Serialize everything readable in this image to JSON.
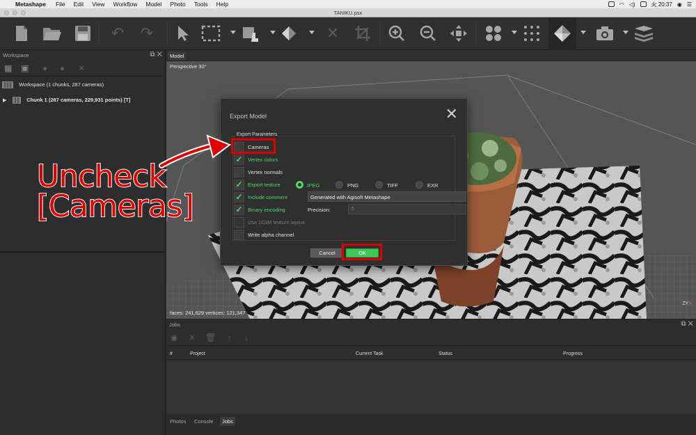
{
  "mac_menubar": {
    "app_name": "Metashape",
    "menus": [
      "File",
      "Edit",
      "View",
      "Workflow",
      "Model",
      "Photo",
      "Tools",
      "Help"
    ],
    "clock": "火 20:37"
  },
  "window": {
    "title": "TANIKU.psx"
  },
  "toolbar": {
    "buttons": [
      {
        "icon": "new-document-icon",
        "enabled": true
      },
      {
        "icon": "open-folder-icon",
        "enabled": true
      },
      {
        "icon": "save-icon",
        "enabled": true
      },
      {
        "icon": "undo-icon",
        "enabled": false
      },
      {
        "icon": "redo-icon",
        "enabled": false
      },
      {
        "icon": "navigation-arrow-icon",
        "enabled": true
      },
      {
        "icon": "rectangle-selection-icon",
        "enabled": true
      },
      {
        "icon": "move-object-icon",
        "enabled": true
      },
      {
        "icon": "rotate-object-icon",
        "enabled": true
      },
      {
        "icon": "delete-selection-icon",
        "enabled": false
      },
      {
        "icon": "crop-selection-icon",
        "enabled": false
      },
      {
        "icon": "zoom-in-icon",
        "enabled": true
      },
      {
        "icon": "zoom-out-icon",
        "enabled": true
      },
      {
        "icon": "reset-view-icon",
        "enabled": true
      },
      {
        "icon": "dense-cloud-icon",
        "enabled": true
      },
      {
        "icon": "point-cloud-icon",
        "enabled": true
      },
      {
        "icon": "model-shaded-icon",
        "enabled": true
      },
      {
        "icon": "camera-icon",
        "enabled": true
      },
      {
        "icon": "layers-icon",
        "enabled": true
      }
    ]
  },
  "workspace": {
    "title": "Workspace",
    "root_label": "Workspace (1 chunks, 287 cameras)",
    "chunk_label": "Chunk 1 (287 cameras, 229,931 points) [T]"
  },
  "model_view": {
    "tab": "Model",
    "projection": "Perspective 30°",
    "stats": "faces: 241,629 vertices: 121,347",
    "axis": {
      "z": "Z",
      "y": "Y",
      "x": "X"
    }
  },
  "jobs": {
    "title": "Jobs",
    "columns": [
      "#",
      "Project",
      "Current Task",
      "Status",
      "Progress"
    ],
    "bottom_tabs": [
      "Photos",
      "Console",
      "Jobs"
    ]
  },
  "dialog": {
    "title": "Export Model",
    "group_label": "Export Parameters",
    "options": {
      "cameras": {
        "label": "Cameras",
        "checked": false
      },
      "vertex_colors": {
        "label": "Vertex colors",
        "checked": true
      },
      "vertex_normals": {
        "label": "Vertex normals",
        "checked": false
      },
      "export_texture": {
        "label": "Export texture",
        "checked": true
      },
      "include_comment": {
        "label": "Include comment",
        "checked": true
      },
      "binary_encoding": {
        "label": "Binary encoding",
        "checked": true
      },
      "udim": {
        "label": "Use UDIM texture layout",
        "checked": false,
        "enabled": false
      },
      "alpha": {
        "label": "Write alpha channel",
        "checked": false
      }
    },
    "texture_formats": {
      "jpeg": "JPEG",
      "png": "PNG",
      "tiff": "TIFF",
      "exr": "EXR",
      "selected": "JPEG"
    },
    "comment_value": "Generated with Agisoft Metashape",
    "precision_label": "Precision:",
    "precision_value": "6",
    "cancel_label": "Cancel",
    "ok_label": "OK"
  },
  "annotation": {
    "line1": "Uncheck",
    "line2": "[Cameras]",
    "color": "#e00000"
  }
}
